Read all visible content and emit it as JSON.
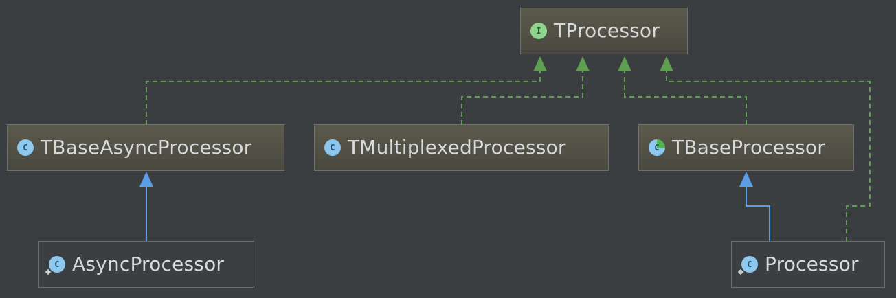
{
  "diagram": {
    "title_node": {
      "name": "TProcessor",
      "kind_icon": "interface-icon",
      "icon_letter": "I"
    },
    "nodes": [
      {
        "name": "TBaseAsyncProcessor",
        "kind_icon": "class-icon",
        "icon_letter": "C"
      },
      {
        "name": "TMultiplexedProcessor",
        "kind_icon": "class-icon",
        "icon_letter": "C"
      },
      {
        "name": "TBaseProcessor",
        "kind_icon": "abstract-class-icon",
        "icon_letter": "C"
      },
      {
        "name": "AsyncProcessor",
        "kind_icon": "inner-class-icon",
        "icon_letter": "C"
      },
      {
        "name": "Processor",
        "kind_icon": "inner-class-icon",
        "icon_letter": "C"
      }
    ],
    "relations": [
      {
        "from": "TBaseAsyncProcessor",
        "to": "TProcessor",
        "type": "implements"
      },
      {
        "from": "TMultiplexedProcessor",
        "to": "TProcessor",
        "type": "implements"
      },
      {
        "from": "TBaseProcessor",
        "to": "TProcessor",
        "type": "implements"
      },
      {
        "from": "Processor",
        "to": "TProcessor",
        "type": "implements"
      },
      {
        "from": "AsyncProcessor",
        "to": "TBaseAsyncProcessor",
        "type": "extends"
      },
      {
        "from": "Processor",
        "to": "TBaseProcessor",
        "type": "extends"
      }
    ],
    "colors": {
      "background": "#3b3e41",
      "implements_line": "#5f9f4f",
      "extends_line": "#5a9ee6"
    }
  }
}
